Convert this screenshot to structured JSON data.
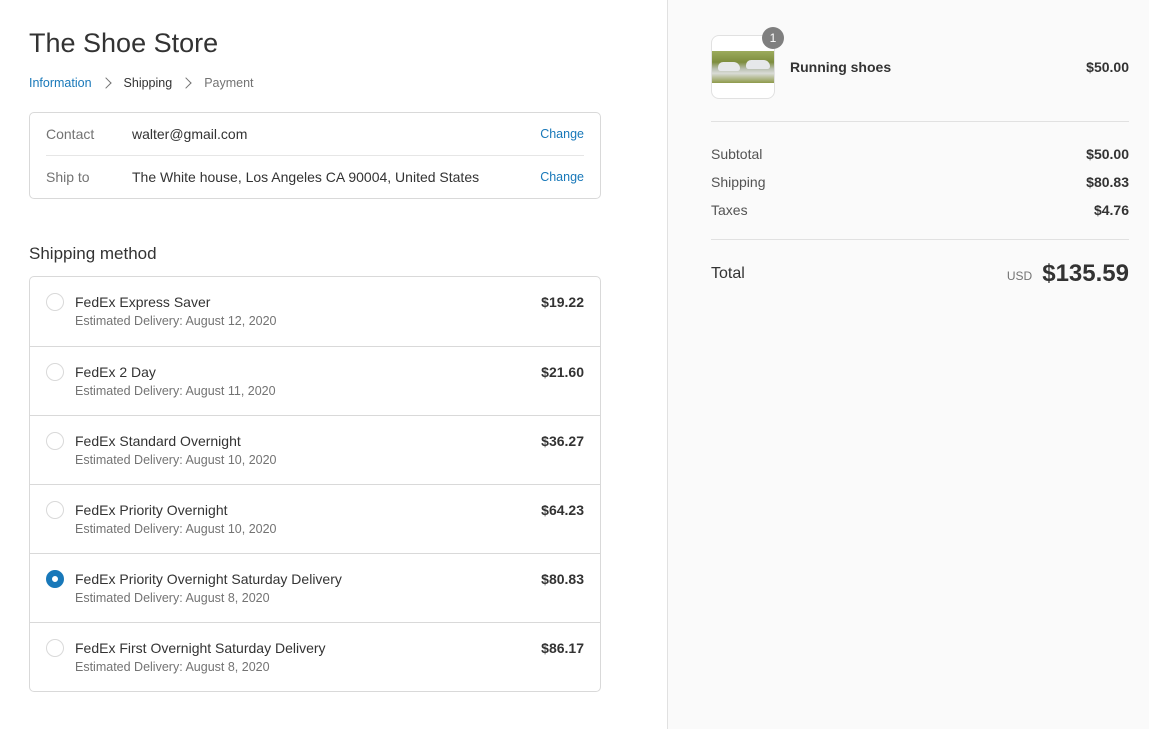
{
  "store": {
    "title": "The Shoe Store"
  },
  "breadcrumb": {
    "information": "Information",
    "shipping": "Shipping",
    "payment": "Payment"
  },
  "review": {
    "contact_label": "Contact",
    "contact_value": "walter@gmail.com",
    "ship_label": "Ship to",
    "ship_value": "The White house, Los Angeles CA 90004, United States",
    "change_label": "Change"
  },
  "shipping": {
    "title": "Shipping method",
    "selected_index": 4,
    "methods": [
      {
        "name": "FedEx Express Saver",
        "eta": "Estimated Delivery: August 12, 2020",
        "price": "$19.22"
      },
      {
        "name": "FedEx 2 Day",
        "eta": "Estimated Delivery: August 11, 2020",
        "price": "$21.60"
      },
      {
        "name": "FedEx Standard Overnight",
        "eta": "Estimated Delivery: August 10, 2020",
        "price": "$36.27"
      },
      {
        "name": "FedEx Priority Overnight",
        "eta": "Estimated Delivery: August 10, 2020",
        "price": "$64.23"
      },
      {
        "name": "FedEx Priority Overnight Saturday Delivery",
        "eta": "Estimated Delivery: August 8, 2020",
        "price": "$80.83"
      },
      {
        "name": "FedEx First Overnight Saturday Delivery",
        "eta": "Estimated Delivery: August 8, 2020",
        "price": "$86.17"
      }
    ]
  },
  "summary": {
    "product": {
      "name": "Running shoes",
      "price": "$50.00",
      "quantity": "1"
    },
    "subtotal_label": "Subtotal",
    "subtotal_value": "$50.00",
    "shipping_label": "Shipping",
    "shipping_value": "$80.83",
    "taxes_label": "Taxes",
    "taxes_value": "$4.76",
    "total_label": "Total",
    "currency": "USD",
    "total_value": "$135.59"
  },
  "colors": {
    "accent": "#1878b9",
    "text": "#333333",
    "muted": "#737373",
    "border": "#d9d9d9",
    "sidebar_bg": "#fafafa"
  }
}
